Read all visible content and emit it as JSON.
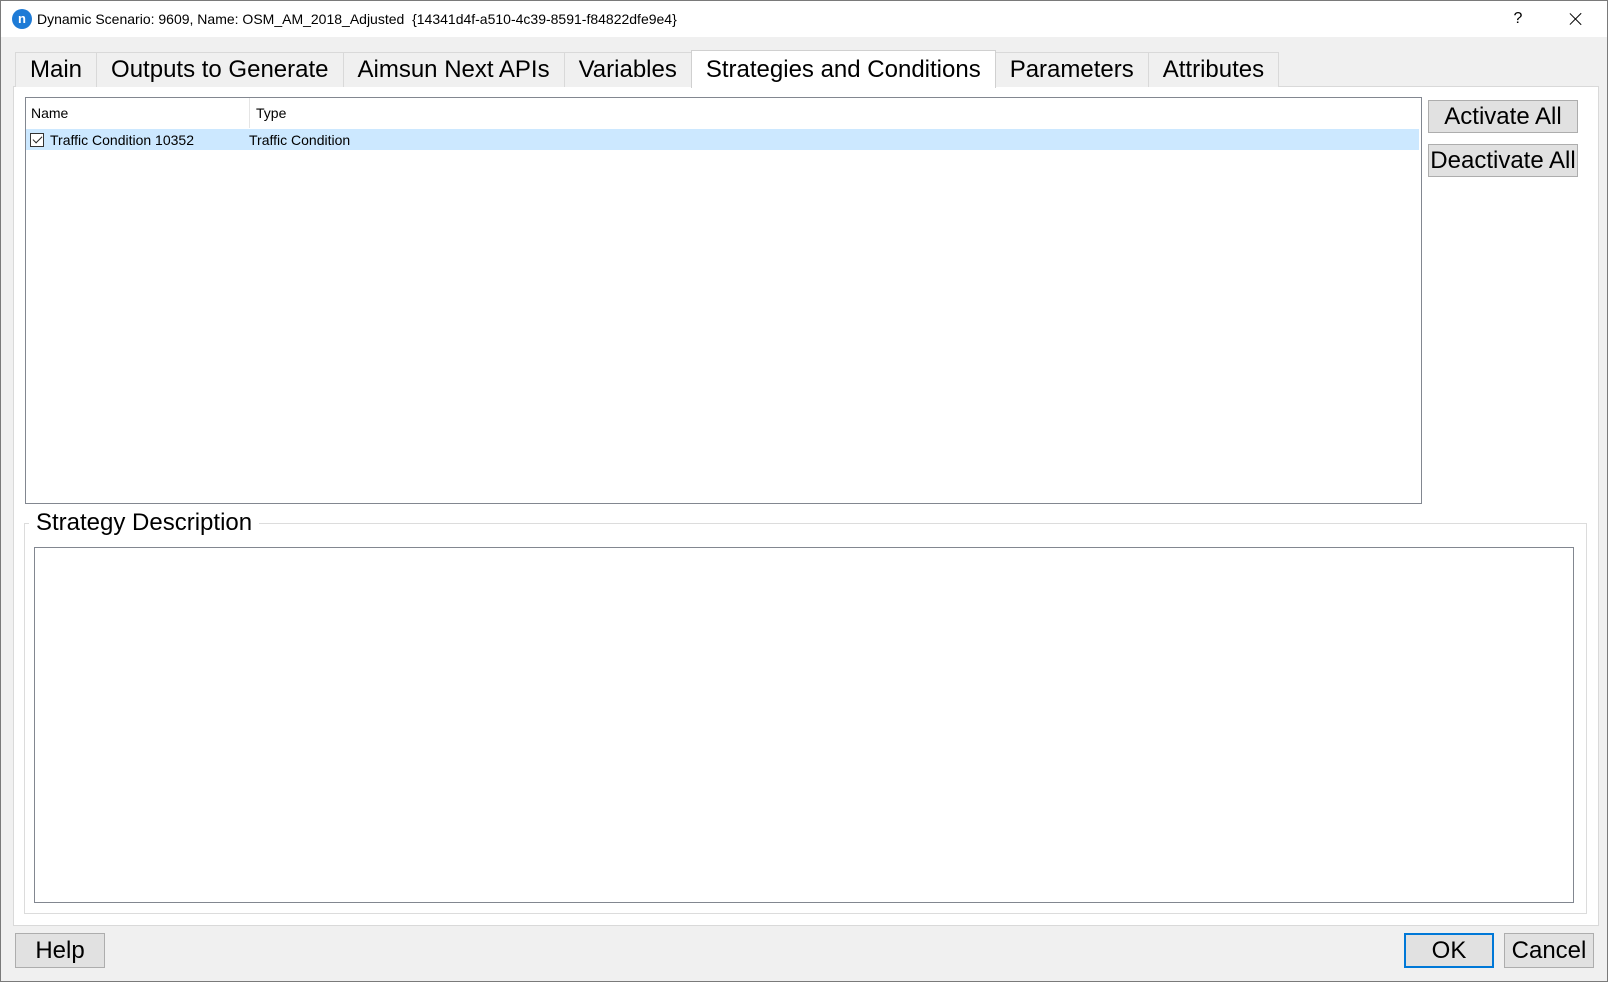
{
  "window": {
    "title": "Dynamic Scenario: 9609, Name: OSM_AM_2018_Adjusted  {14341d4f-a510-4c39-8591-f84822dfe9e4}",
    "app_icon": "n",
    "help_label": "?"
  },
  "tabs": [
    {
      "label": "Main"
    },
    {
      "label": "Outputs to Generate"
    },
    {
      "label": "Aimsun Next APIs"
    },
    {
      "label": "Variables"
    },
    {
      "label": "Strategies and Conditions",
      "active": true
    },
    {
      "label": "Parameters"
    },
    {
      "label": "Attributes"
    }
  ],
  "list": {
    "columns": [
      "Name",
      "Type"
    ],
    "rows": [
      {
        "name": "Traffic Condition 10352",
        "type": "Traffic Condition",
        "checked": true,
        "selected": true
      }
    ]
  },
  "buttons": {
    "activate_all": "Activate All",
    "deactivate_all": "Deactivate All",
    "help": "Help",
    "ok": "OK",
    "cancel": "Cancel"
  },
  "description": {
    "title": "Strategy Description",
    "value": ""
  },
  "colors": {
    "selection": "#cce8ff",
    "app_icon": "#1e7bd6",
    "default_button_border": "#0078d7"
  }
}
